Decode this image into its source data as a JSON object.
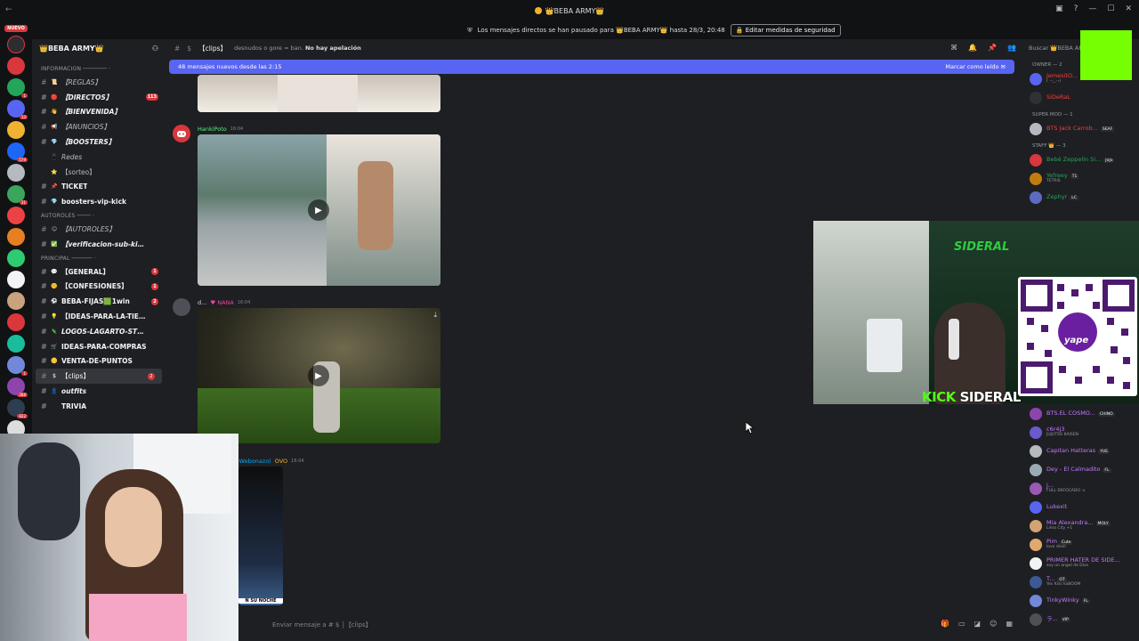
{
  "titlebar": {
    "server_name": "👑BEBA ARMY👑"
  },
  "notice": {
    "text": "Los mensajes directos se han pausado para 👑BEBA ARMY👑 hasta 28/3, 20:48",
    "button": "Editar medidas de seguridad"
  },
  "server_rail": {
    "new_label": "NUEVO"
  },
  "sidebar": {
    "server_name": "👑BEBA ARMY👑",
    "cat_info": "INFORMACION ─────── ·",
    "channels_info": [
      {
        "label": "【REGLAS】",
        "emo": "📜"
      },
      {
        "label": "【DIRECTOS】",
        "emo": "🔴",
        "badge": "113"
      },
      {
        "label": "【BIENVENIDA】",
        "emo": "👋"
      },
      {
        "label": "【ANUNCIOS】",
        "emo": "📢"
      },
      {
        "label": "【BOOSTERS】",
        "emo": "💎"
      },
      {
        "label": "Redes",
        "emo": "📱"
      },
      {
        "label": "【sorteo】",
        "emo": "⭐"
      },
      {
        "label": "TICKET",
        "emo": "📌"
      },
      {
        "label": "boosters-vip-kick",
        "emo": "💎"
      }
    ],
    "cat_autoroles": "AUTOROLES ──── ·",
    "channels_autoroles": [
      {
        "label": "【AUTOROLES】",
        "emo": "😊"
      },
      {
        "label": "【verificacion-sub-kic...",
        "emo": "✅"
      }
    ],
    "cat_principal": "PRINCIPAL ────── ·",
    "channels_principal": [
      {
        "label": "【GENERAL】",
        "emo": "💬",
        "badge": "1"
      },
      {
        "label": "【CONFESIONES】",
        "emo": "🤫",
        "badge": "1"
      },
      {
        "label": "BEBA-FIJAS🟩1win",
        "emo": "⚽",
        "badge": "2"
      },
      {
        "label": "【IDEAS-PARA-LA-TIEN...",
        "emo": "💡"
      },
      {
        "label": "LOGOS-LAGARTO-STORE",
        "emo": "🦎"
      },
      {
        "label": "IDEAS-PARA-COMPRAS",
        "emo": "🛒"
      },
      {
        "label": "VENTA-DE-PUNTOS",
        "emo": "🪙"
      },
      {
        "label": "【clips】",
        "emo": "$",
        "badge": "2"
      },
      {
        "label": "outfits",
        "emo": "👖"
      },
      {
        "label": "TRIVIA",
        "emo": ""
      }
    ]
  },
  "chat": {
    "channel": "【clips】",
    "topic_prefix": "desnudos o gore = ban.",
    "topic_bold": "No hay apelación",
    "new_messages": "48 mensajes nuevos desde las 2:15",
    "mark_read": "Marcar como leído",
    "msg1_author": "HankiPoto",
    "msg1_time": "16:04",
    "msg2_author": "d...",
    "msg2_role": "NANA",
    "msg2_time": "16:04",
    "msg3_author": "(Webonazo)",
    "msg3_role": "OVO",
    "msg3_time": "16:04",
    "clip_caption": "N SU NOCHE",
    "composer": "Enviar mensaje a # $ │【clips】"
  },
  "members": {
    "search": "Buscar 👑BEBA ARMY",
    "cat_owner": "OWNER — 2",
    "owners": [
      {
        "name": "JemesitO...",
        "tag": "Loffy",
        "sub": "( ¬‿¬)",
        "color": "#f23f43"
      },
      {
        "name": "SiDeRaL",
        "sub": "",
        "color": "#f23f43"
      }
    ],
    "cat_supermod": "SUPER MOD — 1",
    "supermods": [
      {
        "name": "BTS Jack Carrob...",
        "tag": "SEAF",
        "sub": "",
        "color": "#f0b232"
      }
    ],
    "cat_staff": "STAFF 👑 — 3",
    "staff": [
      {
        "name": "Bebé Zeppelin Si...",
        "tag": "JoJo",
        "sub": "",
        "color": "#23a55a"
      },
      {
        "name": "Yefreey",
        "tag": "T1",
        "sub": "TETRIS",
        "color": "#23a55a"
      },
      {
        "name": "Zephyr",
        "tag": "LC",
        "sub": "",
        "color": "#23a55a"
      }
    ],
    "others": [
      {
        "name": "BTS.EL COSMO...",
        "tag": "CHINO",
        "sub": "",
        "color": "#c27cff"
      },
      {
        "name": "c6r4j3",
        "tag": "",
        "sub": "JUJUTSU KAISEN",
        "color": "#c27cff"
      },
      {
        "name": "Capitan Hatteras",
        "tag": "YUE",
        "sub": "",
        "color": "#c27cff"
      },
      {
        "name": "Dey - El Calmadito",
        "tag": "FL",
        "sub": "",
        "color": "#c27cff"
      },
      {
        "name": "j...",
        "tag": "",
        "sub": "FULL ENFOCADO :v",
        "color": "#c27cff"
      },
      {
        "name": "Lukexit",
        "tag": "",
        "sub": "",
        "color": "#c27cff"
      },
      {
        "name": "Mia Alexandra...",
        "tag": "MOLY",
        "sub": "Lima City +1",
        "color": "#c27cff"
      },
      {
        "name": "Pim",
        "tag": "Cute",
        "sub": "love devil",
        "color": "#c27cff"
      },
      {
        "name": "PRIMER HATER DE SIDE...",
        "tag": "",
        "sub": "soy un angel de Dios",
        "color": "#c27cff"
      },
      {
        "name": "T...",
        "tag": "OT",
        "sub": "Yes Kiss kaBOOM",
        "color": "#c27cff"
      },
      {
        "name": "TinkyWinky",
        "tag": "FL",
        "sub": "",
        "color": "#c27cff"
      },
      {
        "name": "ラ...",
        "tag": "VIP",
        "sub": "",
        "color": "#c27cff"
      }
    ]
  },
  "stream": {
    "kick_word": "KICK",
    "sideral_word": "SIDERAL",
    "logo_text": "SIDERAL",
    "qr_label": "yape"
  },
  "colors": {
    "blurple": "#5865f2",
    "kick_green": "#53fc18",
    "overlay_green": "#76ff03",
    "badge_red": "#da373c"
  }
}
